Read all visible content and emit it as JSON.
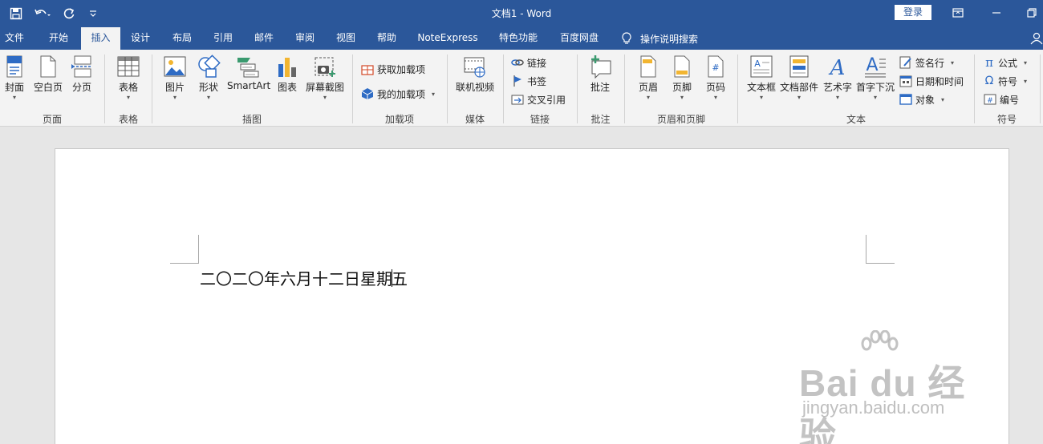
{
  "window": {
    "title": "文档1  -  Word",
    "login_label": "登录"
  },
  "tabs": [
    "文件",
    "开始",
    "插入",
    "设计",
    "布局",
    "引用",
    "邮件",
    "审阅",
    "视图",
    "帮助",
    "NoteExpress",
    "特色功能",
    "百度网盘"
  ],
  "active_tab": "插入",
  "tellme": {
    "label": "操作说明搜索"
  },
  "ribbon": {
    "pages": {
      "group": "页面",
      "cover": "封面",
      "blank": "空白页",
      "break": "分页"
    },
    "tables": {
      "group": "表格",
      "table": "表格"
    },
    "illustrations": {
      "group": "插图",
      "picture": "图片",
      "shapes": "形状",
      "smartart": "SmartArt",
      "chart": "图表",
      "screenshot": "屏幕截图"
    },
    "addins": {
      "group": "加载项",
      "get": "获取加载项",
      "my": "我的加载项"
    },
    "media": {
      "group": "媒体",
      "video": "联机视频"
    },
    "links": {
      "group": "链接",
      "link": "链接",
      "bookmark": "书签",
      "crossref": "交叉引用"
    },
    "comments": {
      "group": "批注",
      "comment": "批注"
    },
    "headerfooter": {
      "group": "页眉和页脚",
      "header": "页眉",
      "footer": "页脚",
      "pagenum": "页码"
    },
    "text": {
      "group": "文本",
      "textbox": "文本框",
      "quickparts": "文档部件",
      "wordart": "艺术字",
      "dropcap": "首字下沉",
      "signature": "签名行",
      "datetime": "日期和时间",
      "object": "对象"
    },
    "symbols": {
      "group": "符号",
      "equation": "公式",
      "symbol": "符号",
      "number": "编号"
    }
  },
  "document": {
    "text_before_caret": "二〇二〇年六月十二日星期",
    "text_after_caret": "五"
  },
  "watermark": {
    "main": "Bai du 经验",
    "sub": "jingyan.baidu.com"
  },
  "colors": {
    "accent": "#2b579a",
    "ribbon_bg": "#f3f3f3",
    "canvas_bg": "#e6e6e6"
  }
}
